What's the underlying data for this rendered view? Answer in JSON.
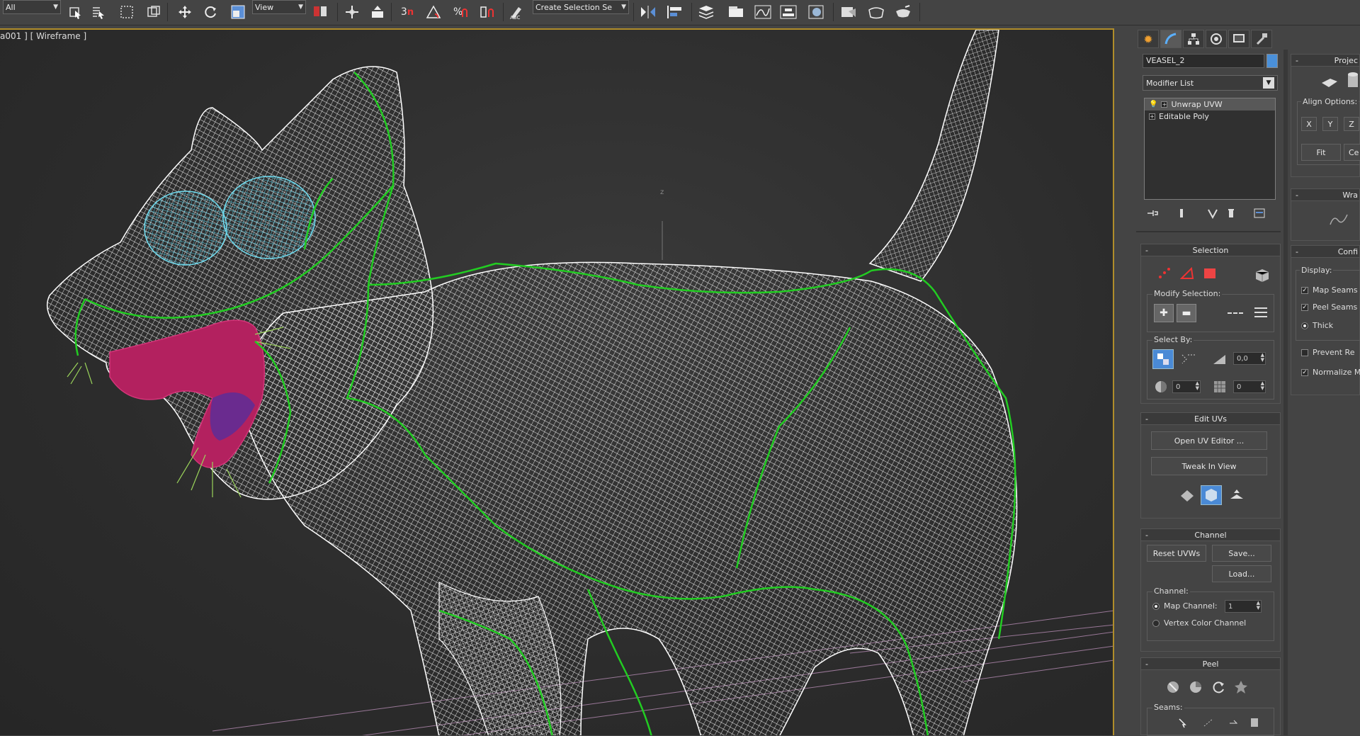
{
  "toolbar": {
    "filter_select": "All",
    "ref_coord_select": "View",
    "selection_set_select": "Create Selection Se",
    "snap_3_label": "3",
    "snap_n_label": "n"
  },
  "viewport": {
    "label": "a001 ] [ Wireframe ]",
    "axis_label": "z"
  },
  "command_panel": {
    "object_name": "VEASEL_2",
    "object_color": "#4a90d9",
    "modifier_list": "Modifier List",
    "stack": [
      "Unwrap UVW",
      "Editable Poly"
    ],
    "selection": {
      "title": "Selection",
      "modify_selection_label": "Modify Selection:",
      "select_by_label": "Select By:",
      "angle_value": "0,0",
      "spin_a": "0",
      "spin_b": "0"
    },
    "edit_uvs": {
      "title": "Edit UVs",
      "open_editor": "Open UV Editor ...",
      "tweak": "Tweak In View"
    },
    "channel": {
      "title": "Channel",
      "reset": "Reset UVWs",
      "save": "Save...",
      "load": "Load...",
      "channel_label": "Channel:",
      "map_channel": "Map Channel:",
      "map_channel_value": "1",
      "vertex_color": "Vertex Color Channel"
    },
    "peel": {
      "title": "Peel",
      "seams_label": "Seams:"
    }
  },
  "side_panel": {
    "projection_title": "Projec",
    "align_options": "Align Options:",
    "x": "X",
    "y": "Y",
    "z": "Z",
    "fit": "Fit",
    "ce": "Ce",
    "wrap_title": "Wra",
    "config_title": "Confi",
    "display_label": "Display:",
    "map_seams": "Map Seams",
    "peel_seams": "Peel Seams",
    "thick": "Thick",
    "prevent": "Prevent Re",
    "normalize": "Normalize M"
  }
}
